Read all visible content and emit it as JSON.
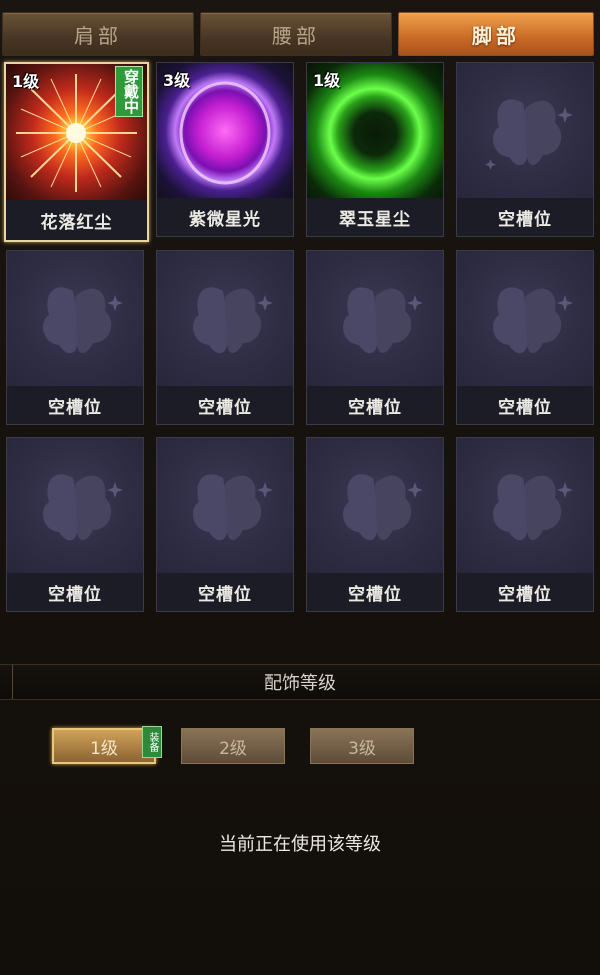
{
  "tabs": [
    "肩部",
    "腰部",
    "脚部"
  ],
  "active_tab": "脚部",
  "slots": [
    {
      "name": "花落红尘",
      "level": "1级",
      "wearing": "穿戴中",
      "gem": "red-star-gem-icon"
    },
    {
      "name": "紫微星光",
      "level": "3级",
      "gem": "purple-orb-gem-icon"
    },
    {
      "name": "翠玉星尘",
      "level": "1级",
      "gem": "green-ring-gem-icon"
    },
    {
      "name": "空槽位"
    },
    {
      "name": "空槽位"
    },
    {
      "name": "空槽位"
    },
    {
      "name": "空槽位"
    },
    {
      "name": "空槽位"
    },
    {
      "name": "空槽位"
    },
    {
      "name": "空槽位"
    },
    {
      "name": "空槽位"
    },
    {
      "name": "空槽位"
    }
  ],
  "level_section": {
    "title": "配饰等级",
    "buttons": [
      "1级",
      "2级",
      "3级"
    ],
    "active": "1级",
    "equip_badge": "装备",
    "status": "当前正在使用该等级"
  },
  "colors": {
    "active_tab": "#d9883a",
    "wearing_badge": "#2e9a3a",
    "selected_border": "#e8d6a0"
  }
}
